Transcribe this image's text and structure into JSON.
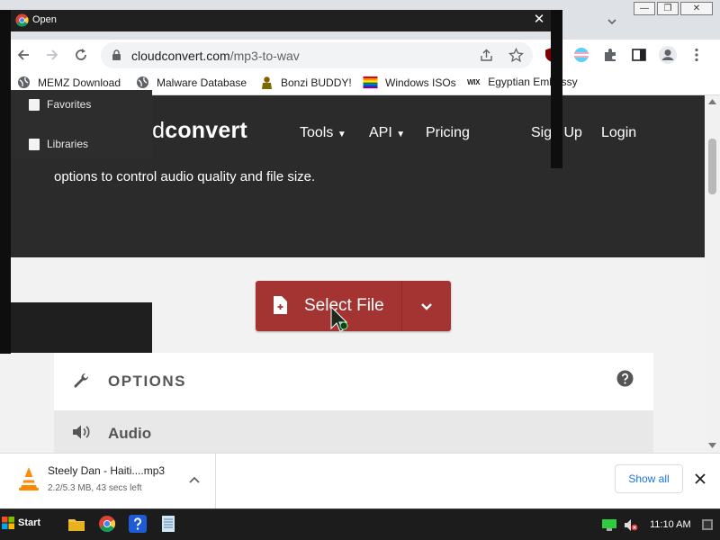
{
  "dialog": {
    "title": "Open",
    "close_glyph": "✕",
    "nav_items": [
      "Favorites",
      "Libraries"
    ]
  },
  "browser": {
    "address": {
      "domain": "cloudconvert.com",
      "path": "/mp3-to-wav"
    },
    "bookmarks": [
      {
        "label": "MEMZ Download",
        "icon": "globe-icon"
      },
      {
        "label": "Malware Database",
        "icon": "globe-icon"
      },
      {
        "label": "Bonzi BUDDY!",
        "icon": "bonzi-icon"
      },
      {
        "label": "Windows ISOs",
        "icon": "rainbow-flag-icon"
      },
      {
        "label": "Egyptian Embassy",
        "icon": "wix-icon",
        "icon_text": "WIX"
      }
    ]
  },
  "page": {
    "brand_light": "ud",
    "brand_bold": "convert",
    "nav": [
      "Tools",
      "API",
      "Pricing",
      "Sign Up",
      "Login"
    ],
    "hero_text": "options to control audio quality and file size.",
    "select_file": "Select File",
    "options_heading": "OPTIONS",
    "audio_heading": "Audio",
    "accent": "#a33432"
  },
  "download": {
    "filename": "Steely Dan - Haiti....mp3",
    "status": "2.2/5.3 MB, 43 secs left",
    "show_all": "Show all"
  },
  "taskbar": {
    "start": "Start",
    "time": "11:10 AM"
  }
}
